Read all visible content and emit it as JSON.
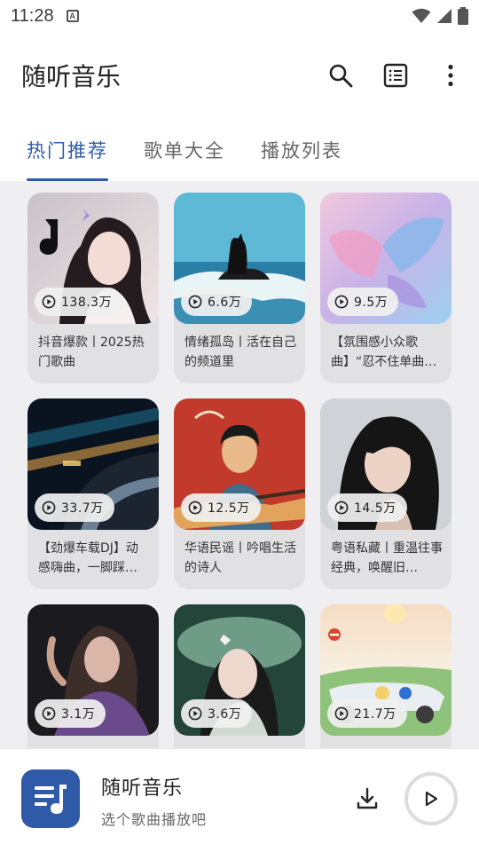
{
  "status_bar": {
    "time": "11:28",
    "notification_badge": "A"
  },
  "app_bar": {
    "title": "随听音乐",
    "icons": [
      "search-icon",
      "list-icon",
      "more-vert-icon"
    ]
  },
  "tabs": [
    {
      "label": "热门推荐",
      "active": true
    },
    {
      "label": "歌单大全",
      "active": false
    },
    {
      "label": "播放列表",
      "active": false
    }
  ],
  "playlists": [
    {
      "count": "138.3万",
      "title": "抖音爆款丨2025热门歌曲"
    },
    {
      "count": "6.6万",
      "title": "情绪孤岛丨活在自己的频道里"
    },
    {
      "count": "9.5万",
      "title": "【氛围感小众歌曲】“忍不住单曲…"
    },
    {
      "count": "33.7万",
      "title": "【劲爆车载DJ】动感嗨曲，一脚踩…"
    },
    {
      "count": "12.5万",
      "title": "华语民谣丨吟唱生活的诗人"
    },
    {
      "count": "14.5万",
      "title": "粤语私藏丨重温往事经典，唤醒旧…"
    },
    {
      "count": "3.1万",
      "title": ""
    },
    {
      "count": "3.6万",
      "title": ""
    },
    {
      "count": "21.7万",
      "title": ""
    }
  ],
  "player": {
    "title": "随听音乐",
    "subtitle": "选个歌曲播放吧"
  },
  "colors": {
    "accent": "#2f5aa8",
    "content_bg": "#efeff1",
    "card_bg": "#e1e1e4"
  }
}
